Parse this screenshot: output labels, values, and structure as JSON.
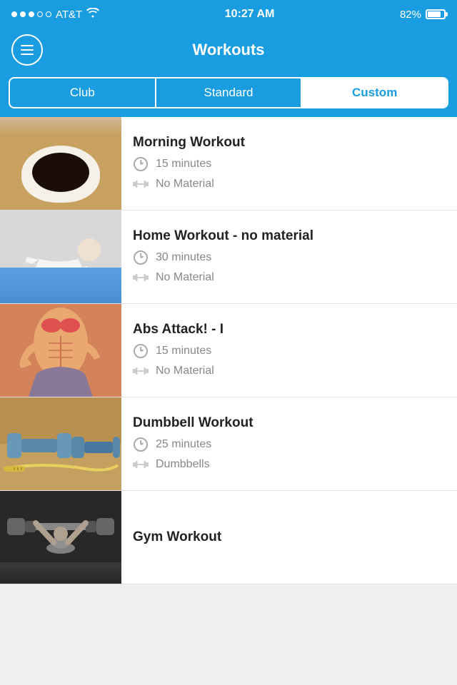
{
  "status": {
    "carrier": "AT&T",
    "time": "10:27 AM",
    "battery": "82%"
  },
  "header": {
    "title": "Workouts"
  },
  "tabs": [
    {
      "id": "club",
      "label": "Club",
      "active": false
    },
    {
      "id": "standard",
      "label": "Standard",
      "active": false
    },
    {
      "id": "custom",
      "label": "Custom",
      "active": true
    }
  ],
  "workouts": [
    {
      "id": 1,
      "name": "Morning Workout",
      "duration": "15 minutes",
      "material": "No Material",
      "thumb": "coffee"
    },
    {
      "id": 2,
      "name": "Home Workout - no material",
      "duration": "30 minutes",
      "material": "No Material",
      "thumb": "pushup"
    },
    {
      "id": 3,
      "name": "Abs Attack! - I",
      "duration": "15 minutes",
      "material": "No Material",
      "thumb": "abs"
    },
    {
      "id": 4,
      "name": "Dumbbell Workout",
      "duration": "25 minutes",
      "material": "Dumbbells",
      "thumb": "dumbbell"
    },
    {
      "id": 5,
      "name": "Gym Workout",
      "duration": "",
      "material": "",
      "thumb": "gym"
    }
  ],
  "icons": {
    "menu": "☰",
    "clock": "⏱",
    "dumbbell": "🏋"
  }
}
